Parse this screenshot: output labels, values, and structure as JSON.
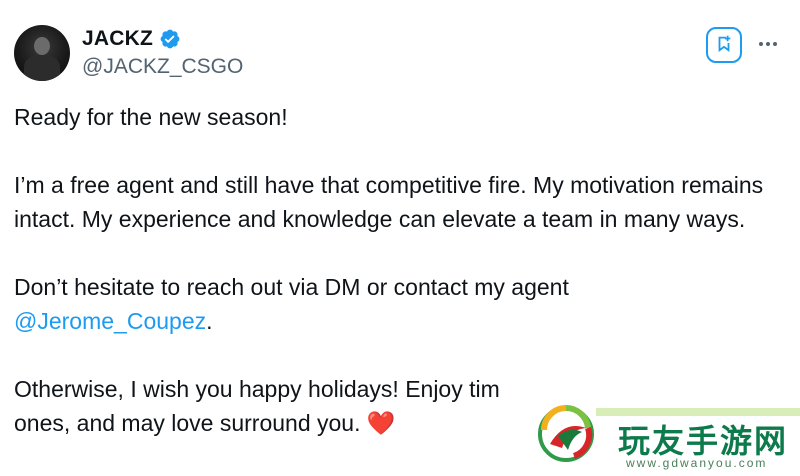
{
  "author": {
    "display_name": "JACKZ",
    "handle": "@JACKZ_CSGO",
    "verified": true
  },
  "actions": {
    "grok_icon": "grok-bookmark-icon",
    "more_icon": "more-dots-icon"
  },
  "tweet": {
    "line1": "Ready for the new season!",
    "para2": "I’m a free agent and still have that competitive fire. My motivation remains intact. My experience and knowledge can elevate a team in many ways.",
    "para3_text": "Don’t hesitate to reach out via DM or contact my agent",
    "para3_mention": "@Jerome_Coupez",
    "para3_end": ".",
    "para4_text": "Otherwise, I wish you happy holidays! Enjoy tim",
    "para4_text2": "ones, and may love surround you.",
    "heart": "❤️"
  },
  "watermark": {
    "title": "玩友手游网",
    "url": "www.gdwanyou.com"
  },
  "colors": {
    "accent": "#1d9bf0",
    "text": "#0f1419",
    "secondary": "#536471",
    "heart": "#e0245e"
  }
}
